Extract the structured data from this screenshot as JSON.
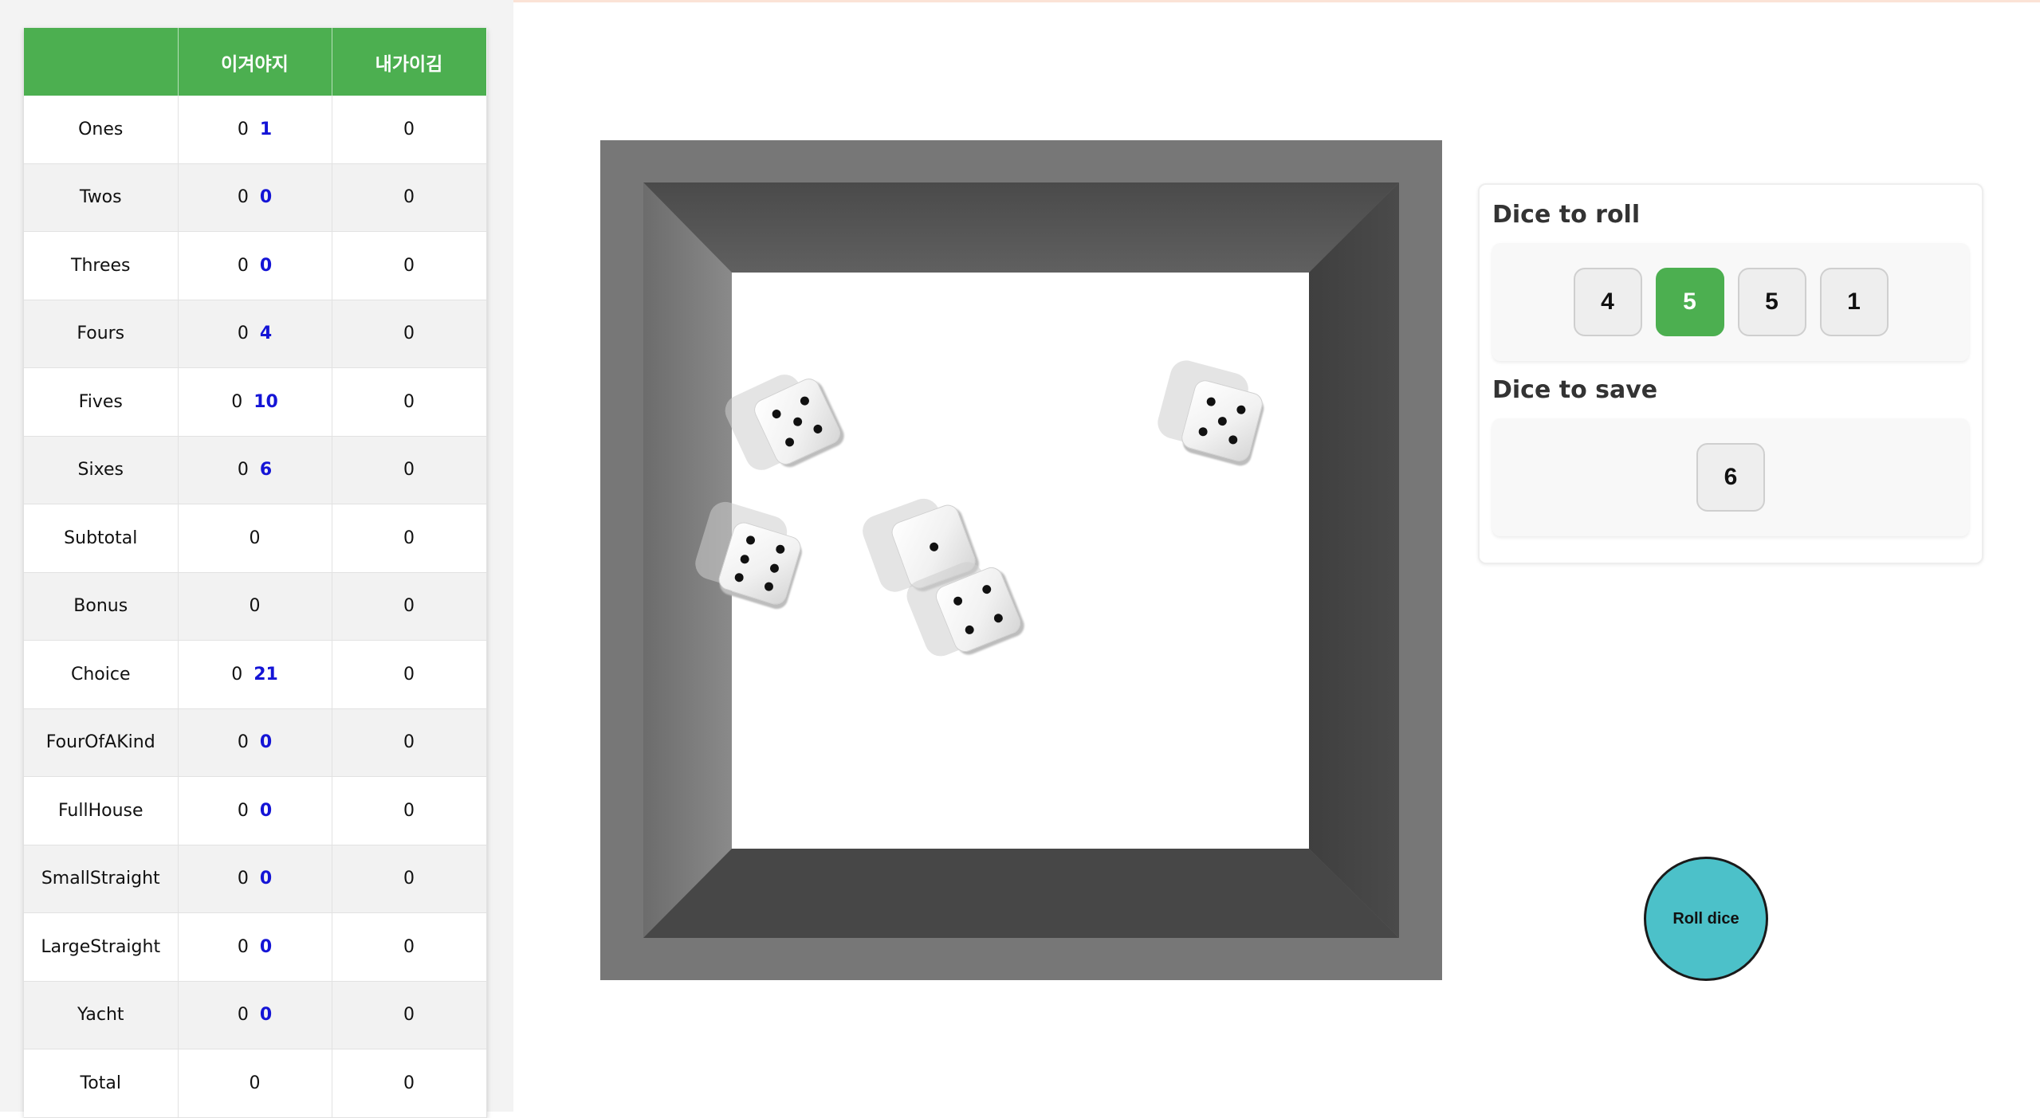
{
  "scoreboard": {
    "headers": [
      "",
      "이겨야지",
      "내가이김"
    ],
    "rows": [
      {
        "category": "Ones",
        "p1_score": "0",
        "p1_potential": "1",
        "p2_score": "0"
      },
      {
        "category": "Twos",
        "p1_score": "0",
        "p1_potential": "0",
        "p2_score": "0"
      },
      {
        "category": "Threes",
        "p1_score": "0",
        "p1_potential": "0",
        "p2_score": "0"
      },
      {
        "category": "Fours",
        "p1_score": "0",
        "p1_potential": "4",
        "p2_score": "0"
      },
      {
        "category": "Fives",
        "p1_score": "0",
        "p1_potential": "10",
        "p2_score": "0"
      },
      {
        "category": "Sixes",
        "p1_score": "0",
        "p1_potential": "6",
        "p2_score": "0"
      },
      {
        "category": "Subtotal",
        "p1_score": "0",
        "p2_score": "0"
      },
      {
        "category": "Bonus",
        "p1_score": "0",
        "p2_score": "0"
      },
      {
        "category": "Choice",
        "p1_score": "0",
        "p1_potential": "21",
        "p2_score": "0"
      },
      {
        "category": "FourOfAKind",
        "p1_score": "0",
        "p1_potential": "0",
        "p2_score": "0"
      },
      {
        "category": "FullHouse",
        "p1_score": "0",
        "p1_potential": "0",
        "p2_score": "0"
      },
      {
        "category": "SmallStraight",
        "p1_score": "0",
        "p1_potential": "0",
        "p2_score": "0"
      },
      {
        "category": "LargeStraight",
        "p1_score": "0",
        "p1_potential": "0",
        "p2_score": "0"
      },
      {
        "category": "Yacht",
        "p1_score": "0",
        "p1_potential": "0",
        "p2_score": "0"
      },
      {
        "category": "Total",
        "p1_score": "0",
        "p2_score": "0"
      }
    ]
  },
  "board": {
    "dice_faces_shown": [
      5,
      5,
      6,
      1,
      4
    ]
  },
  "dice_panel": {
    "roll_title": "Dice to roll",
    "roll_dice": [
      {
        "value": "4",
        "selected": false
      },
      {
        "value": "5",
        "selected": true
      },
      {
        "value": "5",
        "selected": false
      },
      {
        "value": "1",
        "selected": false
      }
    ],
    "save_title": "Dice to save",
    "save_dice": [
      {
        "value": "6"
      }
    ]
  },
  "roll_button": {
    "label": "Roll dice"
  },
  "colors": {
    "header_green": "#4caf50",
    "potential_blue": "#1414d6",
    "selected_die": "#4caf50",
    "roll_button": "#4cc1c9"
  }
}
